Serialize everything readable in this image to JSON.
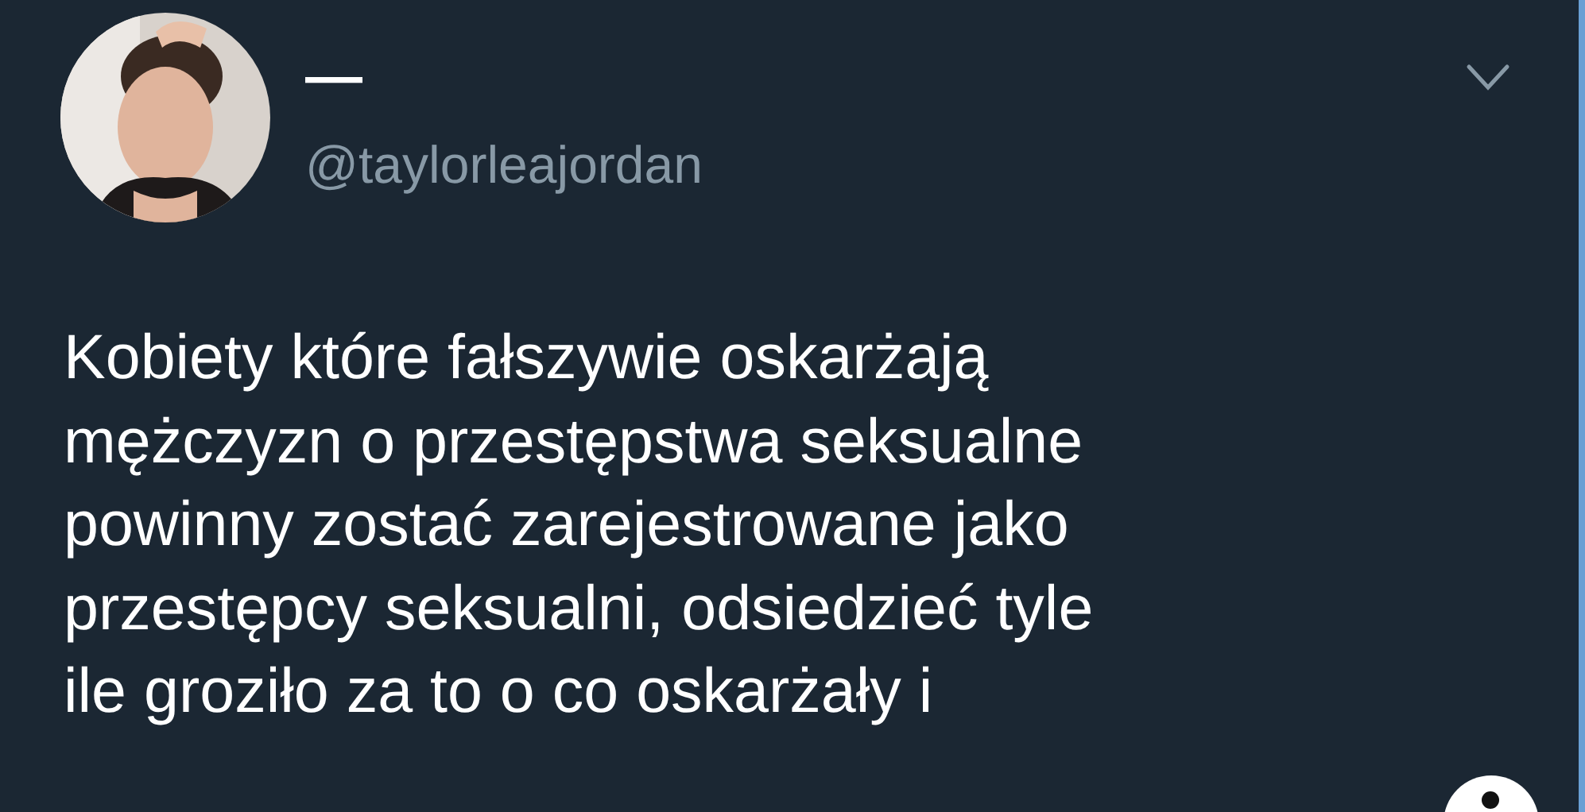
{
  "tweet": {
    "author": {
      "display_name": "—",
      "handle": "@taylorleajordan"
    },
    "menu": {
      "expanded": false
    },
    "text": "Kobiety które fałszywie oskarżają\nmężczyzn o przestępstwa seksualne\npowinny zostać zarejestrowane jako\nprzestępcy seksualni, odsiedzieć tyle\nile groziło za to o co oskarżały i"
  }
}
